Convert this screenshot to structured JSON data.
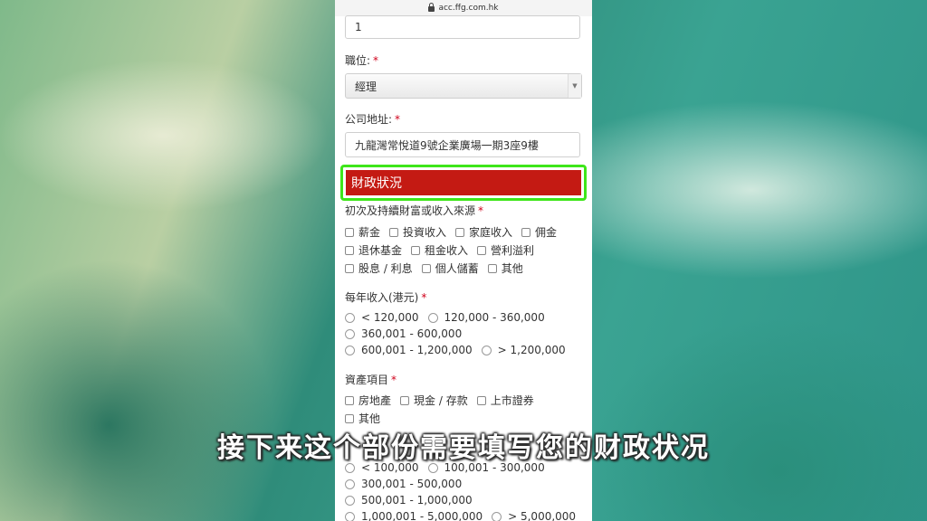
{
  "browser": {
    "url": "acc.ffg.com.hk"
  },
  "form": {
    "top_field_value": "1",
    "position": {
      "label": "職位:",
      "required": "*",
      "selected": "經理"
    },
    "company_address": {
      "label": "公司地址:",
      "required": "*",
      "value": "九龍灣常悅道9號企業廣場一期3座9樓"
    },
    "section_title": "財政狀況",
    "wealth_source": {
      "label": "初次及持續財富或收入來源",
      "required": "*",
      "rows": [
        [
          "薪金",
          "投資收入",
          "家庭收入",
          "佣金"
        ],
        [
          "退休基金",
          "租金收入",
          "營利溢利"
        ],
        [
          "股息 / 利息",
          "個人儲蓄",
          "其他"
        ]
      ]
    },
    "annual_income": {
      "label": "每年收入(港元)",
      "required": "*",
      "rows": [
        [
          "< 120,000",
          "120,000 - 360,000"
        ],
        [
          "360,001 - 600,000"
        ],
        [
          "600,001 - 1,200,000",
          "> 1,200,000"
        ]
      ]
    },
    "assets": {
      "label": "資產項目",
      "required": "*",
      "rows": [
        [
          "房地產",
          "現金 / 存款",
          "上市證券"
        ],
        [
          "其他"
        ]
      ]
    },
    "net_assets": {
      "rows": [
        [
          "< 100,000",
          "100,001 - 300,000"
        ],
        [
          "300,001 - 500,000"
        ],
        [
          "500,001 - 1,000,000"
        ],
        [
          "1,000,001 - 5,000,000",
          "> 5,000,000"
        ]
      ]
    }
  },
  "caption": "接下来这个部份需要填写您的财政状况"
}
